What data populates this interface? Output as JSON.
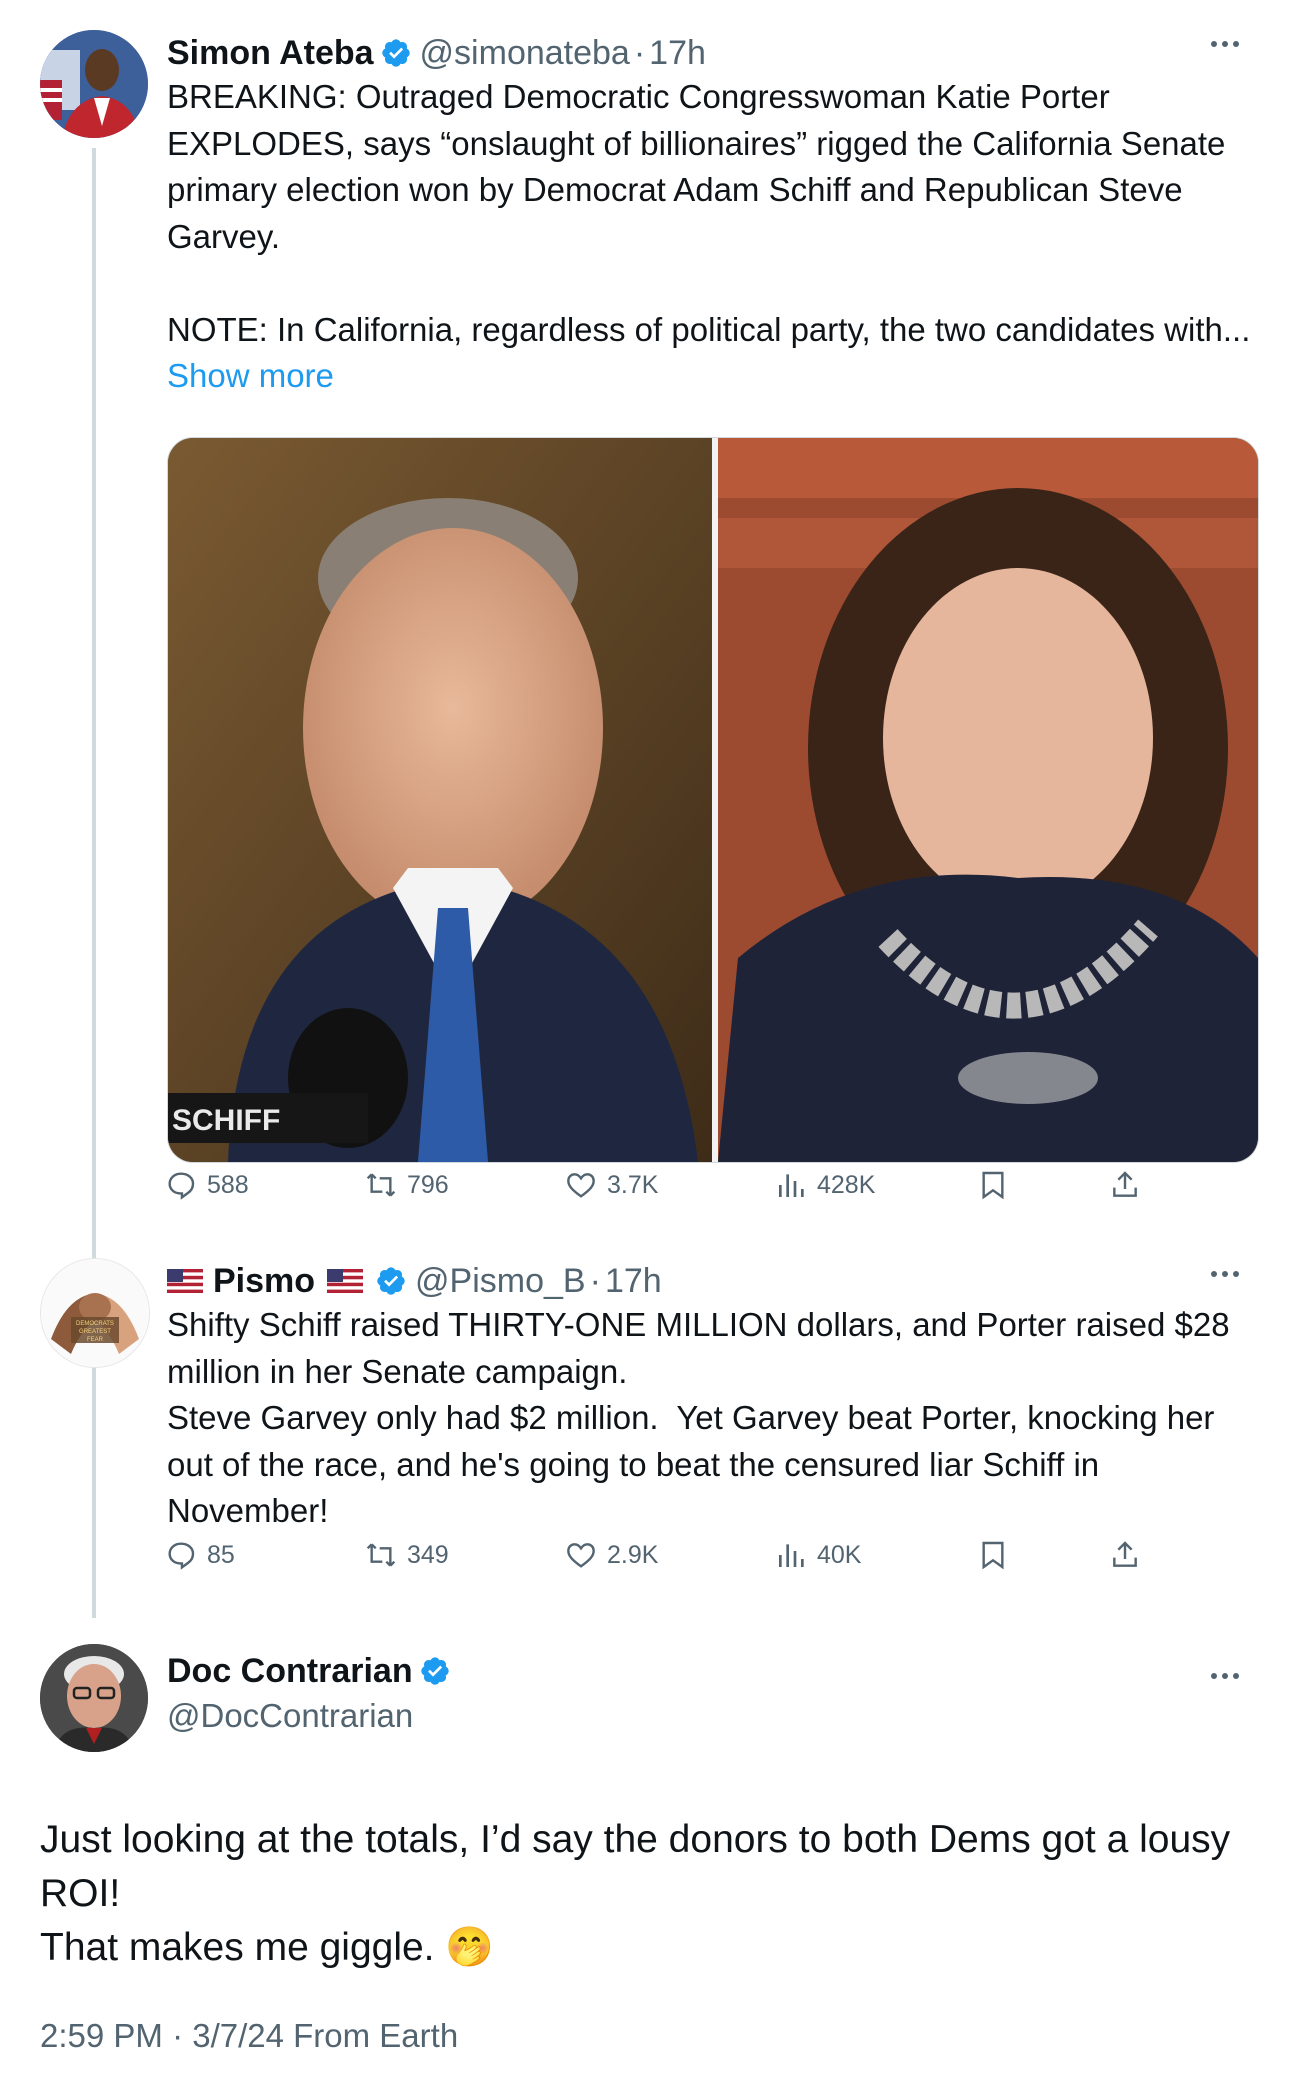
{
  "tweet1": {
    "name": "Simon Ateba",
    "handle": "@simonateba",
    "separator": "·",
    "time": "17h",
    "text": "BREAKING: Outraged Democratic Congresswoman Katie Porter EXPLODES, says “onslaught of billionaires” rigged the California Senate primary election won by Democrat Adam Schiff and Republican Steve Garvey.\n\nNOTE: In California, regardless of political party, the two candidates with...",
    "show_more": "Show more",
    "nameplate": "SCHIFF",
    "stats": {
      "replies": "588",
      "reposts": "796",
      "likes": "3.7K",
      "views": "428K"
    }
  },
  "tweet2": {
    "name": "Pismo",
    "handle": "@Pismo_B",
    "separator": "·",
    "time": "17h",
    "avatar_text": "DEMOCRATS GREATEST FEAR",
    "text": "Shifty Schiff raised THIRTY-ONE MILLION dollars, and Porter raised $28 million in her Senate campaign.\nSteve Garvey only had $2 million.  Yet Garvey beat Porter, knocking her out of the race, and he's going to beat the censured liar Schiff in November!",
    "stats": {
      "replies": "85",
      "reposts": "349",
      "likes": "2.9K",
      "views": "40K"
    }
  },
  "reply": {
    "name": "Doc Contrarian",
    "handle": "@DocContrarian",
    "text": "Just looking at the totals, I’d say the donors to both Dems got a lousy ROI!\nThat makes me giggle. ",
    "emoji": "🤭",
    "footer": "2:59 PM · 3/7/24 From Earth"
  },
  "icons": [
    "verified-icon",
    "more-icon",
    "reply-icon",
    "repost-icon",
    "like-icon",
    "views-icon",
    "bookmark-icon",
    "share-icon",
    "us-flag-icon"
  ],
  "colors": {
    "accent": "#1d9bf0",
    "text": "#0f1419",
    "muted": "#536471",
    "line": "#cfd9de"
  }
}
